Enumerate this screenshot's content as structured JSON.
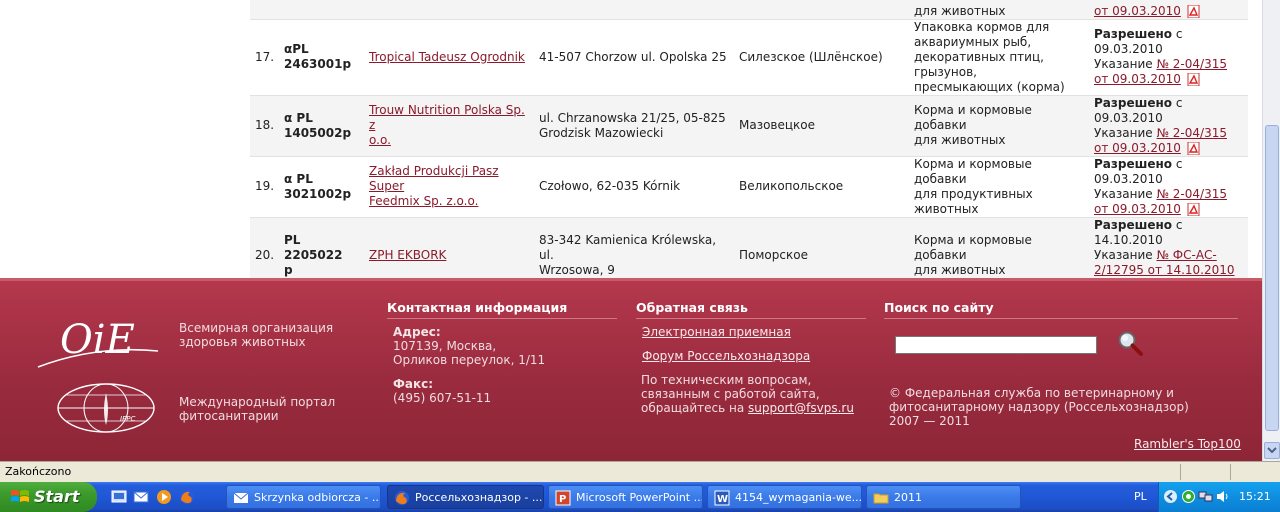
{
  "table": {
    "top_row": {
      "type_text": "для животных",
      "status_date_link": "от 09.03.2010"
    },
    "rows": [
      {
        "num": "17.",
        "reg_line1": "αPL",
        "reg_line2": "2463001p",
        "firm_line1": "Tropical Tadeusz Ogrodnik",
        "firm_line2": "",
        "addr_line1": "41-507 Chorzow ul. Opolska 25",
        "addr_line2": "",
        "region": "Силезское (Шлёнское)",
        "type_lines": [
          "Упаковка кормов для",
          "аквариумных рыб,",
          "декоративных птиц, грызунов,",
          "пресмыкающих (корма)"
        ],
        "status_bold": "Разрешено",
        "status_date": " с 09.03.2010",
        "instruction_prefix": "Указание ",
        "instruction_link": "№ 2-04/315",
        "instruction_date": "от 09.03.2010"
      },
      {
        "num": "18.",
        "reg_line1": "α PL",
        "reg_line2": "1405002p",
        "firm_line1": "Trouw Nutrition Polska Sp. z",
        "firm_line2": "o.o.",
        "addr_line1": "ul. Chrzanowska 21/25, 05-825",
        "addr_line2": "Grodzisk Mazowiecki",
        "region": "Мазовецкое",
        "type_lines": [
          "Корма и кормовые добавки",
          "для животных"
        ],
        "status_bold": "Разрешено",
        "status_date": " с 09.03.2010",
        "instruction_prefix": "Указание ",
        "instruction_link": "№ 2-04/315",
        "instruction_date": "от 09.03.2010"
      },
      {
        "num": "19.",
        "reg_line1": "α PL",
        "reg_line2": "3021002p",
        "firm_line1": "Zakład Produkcji Pasz Super",
        "firm_line2": "Feedmix Sp. z.o.o.",
        "addr_line1": "Czołowo, 62-035 Kórnik",
        "addr_line2": "",
        "region": "Великопольское",
        "type_lines": [
          "Корма и кормовые добавки",
          "для продуктивных животных"
        ],
        "status_bold": "Разрешено",
        "status_date": " с 09.03.2010",
        "instruction_prefix": "Указание ",
        "instruction_link": "№ 2-04/315",
        "instruction_date": "от 09.03.2010"
      },
      {
        "num": "20.",
        "reg_line1": "PL 2205022",
        "reg_line2": "p",
        "firm_line1": "ZPH EKBORK",
        "firm_line2": "",
        "addr_line1": "83-342 Kamienica Królewska, ul.",
        "addr_line2": "Wrzosowa, 9",
        "region": "Поморское",
        "type_lines": [
          "Корма и кормовые добавки",
          "для животных"
        ],
        "status_bold": "Разрешено",
        "status_date": " с 14.10.2010",
        "instruction_prefix": "Указание ",
        "instruction_link": "№ ФС-АС-",
        "instruction_date": "2/12795 от 14.10.2010"
      }
    ]
  },
  "footer": {
    "oie_logo_text": "OiE",
    "oie_caption_1": "Всемирная организация",
    "oie_caption_2": "здоровья животных",
    "ippc_logo_text": "IPPC",
    "ippc_caption_1": "Международный портал",
    "ippc_caption_2": "фитосанитарии",
    "contacts": {
      "heading": "Контактная информация",
      "address_label": "Адрес:",
      "address_1": "107139, Москва,",
      "address_2": "Орликов переулок, 1/11",
      "fax_label": "Факс:",
      "fax_value": "(495) 607-51-11"
    },
    "feedback": {
      "heading": "Обратная связь",
      "link_reception": "Электронная приемная",
      "link_forum": "Форум Россельхознадзора",
      "tech_1": "По техническим вопросам,",
      "tech_2": "связанным с работой сайта,",
      "tech_3": "обращайтесь на ",
      "support_email": "support@fsvps.ru"
    },
    "search": {
      "heading": "Поиск по сайту",
      "placeholder": "",
      "copyright_1": "© Федеральная служба по ветеринарному и",
      "copyright_2": "фитосанитарному надзору (Россельхознадзор)",
      "copyright_3": "2007 — 2011"
    },
    "rambler": "Rambler's Top100"
  },
  "statusbar": {
    "text": "Zakończono"
  },
  "taskbar": {
    "start_label": "Start",
    "tasks": [
      {
        "label": "Skrzynka odbiorcza - ...",
        "active": false
      },
      {
        "label": "Россельхознадзор - ...",
        "active": true
      },
      {
        "label": "Microsoft PowerPoint ...",
        "active": false
      },
      {
        "label": "4154_wymagania-we...",
        "active": false
      },
      {
        "label": "2011",
        "active": false
      }
    ],
    "language": "PL",
    "clock": "15:21"
  },
  "colors": {
    "link": "#8b1a2c",
    "footer_bg": "#9a2b3f",
    "taskbar": "#245edb",
    "start": "#3c9a2c"
  }
}
